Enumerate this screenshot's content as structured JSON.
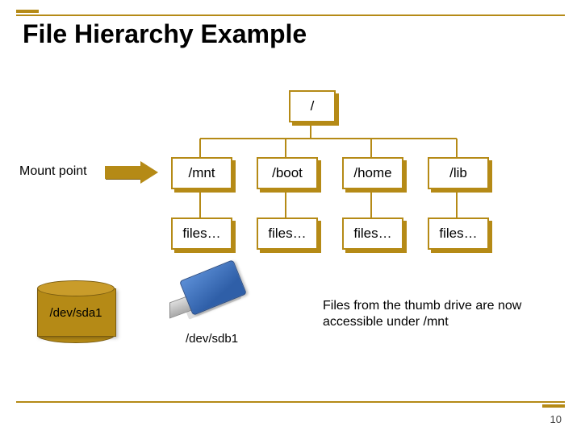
{
  "title": "File Hierarchy Example",
  "page_number": "10",
  "mount_label": "Mount point",
  "tree": {
    "root": "/",
    "mounts": [
      "/mnt",
      "/boot",
      "/home",
      "/lib"
    ],
    "files": [
      "files…",
      "files…",
      "files…",
      "files…"
    ]
  },
  "devices": {
    "disk_label": "/dev/sda1",
    "thumb_label": "/dev/sdb1"
  },
  "caption": "Files from the thumb drive are now accessible under /mnt"
}
